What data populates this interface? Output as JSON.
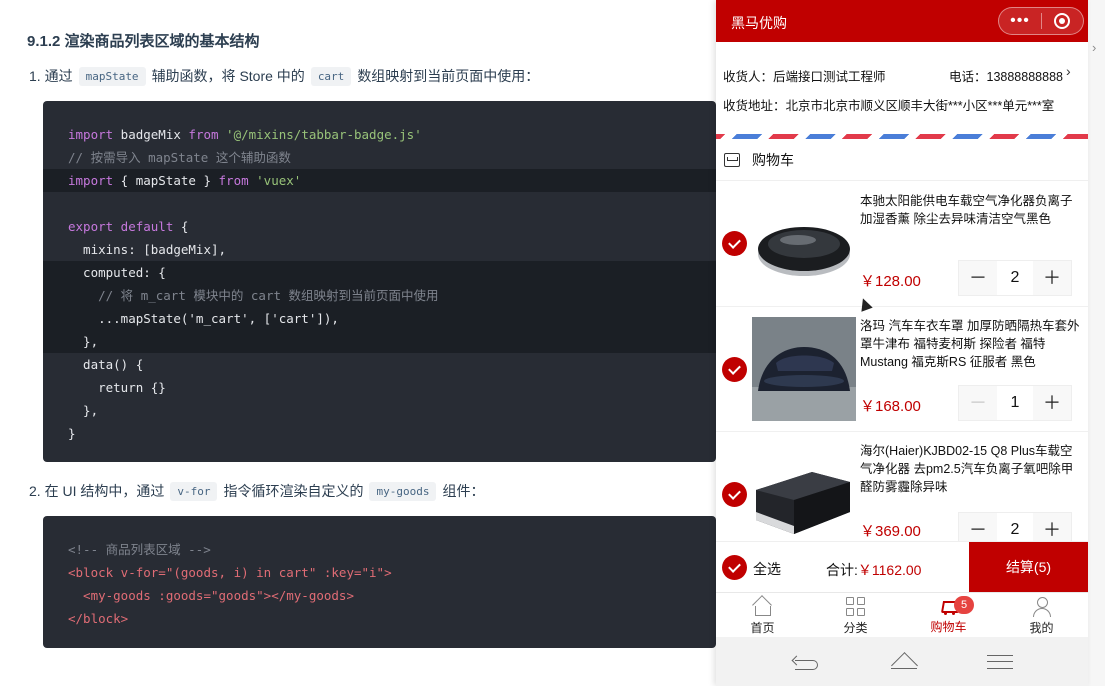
{
  "doc": {
    "heading": "9.1.2 渲染商品列表区域的基本结构",
    "step1": {
      "number": "1.",
      "prefix": "通过",
      "code1": "mapState",
      "middle": "辅助函数，将 Store 中的",
      "code2": "cart",
      "suffix": "数组映射到当前页面中使用："
    },
    "step2": {
      "number": "2.",
      "prefix": "在 UI 结构中，通过",
      "code1": "v-for",
      "middle": "指令循环渲染自定义的",
      "code2": "my-goods",
      "suffix": "组件："
    },
    "code1_lines": [
      {
        "kw": "import",
        "plain": " badgeMix ",
        "kw2": "from",
        "str": " '@/mixins/tabbar-badge.js'"
      },
      {
        "comment": "// 按需导入 mapState 这个辅助函数"
      },
      {
        "kw": "import",
        "plain": " { mapState } ",
        "kw2": "from",
        "str": " 'vuex'"
      },
      {
        "blank": ""
      },
      {
        "kw": "export default",
        "plain": " {"
      },
      {
        "plain": "  mixins: [badgeMix],"
      },
      {
        "plain": "  computed: {"
      },
      {
        "comment": "    // 将 m_cart 模块中的 cart 数组映射到当前页面中使用"
      },
      {
        "plain": "    ...mapState('m_cart', ['cart']),"
      },
      {
        "plain": "  },"
      },
      {
        "plain": "  data() {"
      },
      {
        "plain": "    return {}"
      },
      {
        "plain": "  },"
      },
      {
        "plain": "}"
      }
    ],
    "code2_lines": [
      {
        "comment": "<!-- 商品列表区域 -->"
      },
      {
        "plain": "<block v-for=\"(goods, i) in cart\" :key=\"i\">"
      },
      {
        "plain": "  <my-goods :goods=\"goods\"></my-goods>"
      },
      {
        "plain": "</block>"
      }
    ]
  },
  "phone": {
    "nav_title": "黑马优购",
    "capsule_more": "•••",
    "address": {
      "recipient": "收货人：后端接口测试工程师",
      "phone": "电话：13888888888",
      "arrow": "›",
      "detail": "收货地址：北京市北京市顺义区顺丰大街***小区***单元***室"
    },
    "cart_header": "购物车",
    "goods": [
      {
        "name": "本驰太阳能供电车载空气净化器负离子加湿香薰 除尘去异味清洁空气黑色",
        "price": "￥128.00",
        "count": "2",
        "minus": "－",
        "plus": "＋"
      },
      {
        "name": "洛玛 汽车车衣车罩 加厚防晒隔热车套外罩牛津布 福特麦柯斯 探险者 福特Mustang 福克斯RS 征服者 黑色",
        "price": "￥168.00",
        "count": "1",
        "minus": "－",
        "plus": "＋"
      },
      {
        "name": "海尔(Haier)KJBD02-15 Q8 Plus车载空气净化器 去pm2.5汽车负离子氧吧除甲醛防雾霾除异味",
        "price": "￥369.00",
        "count": "2",
        "minus": "－",
        "plus": "＋"
      }
    ],
    "settle": {
      "select_all": "全选",
      "total_label": "合计:",
      "total_value": "￥1162.00",
      "button": "结算(5)"
    },
    "tabs": [
      {
        "label": "首页",
        "icon": "home-icon"
      },
      {
        "label": "分类",
        "icon": "category-icon"
      },
      {
        "label": "购物车",
        "icon": "cart-icon",
        "badge": "5"
      },
      {
        "label": "我的",
        "icon": "user-icon"
      }
    ],
    "colors": {
      "brand": "#c00000",
      "code_bg": "#282c34"
    }
  },
  "edge_arrow": "›"
}
